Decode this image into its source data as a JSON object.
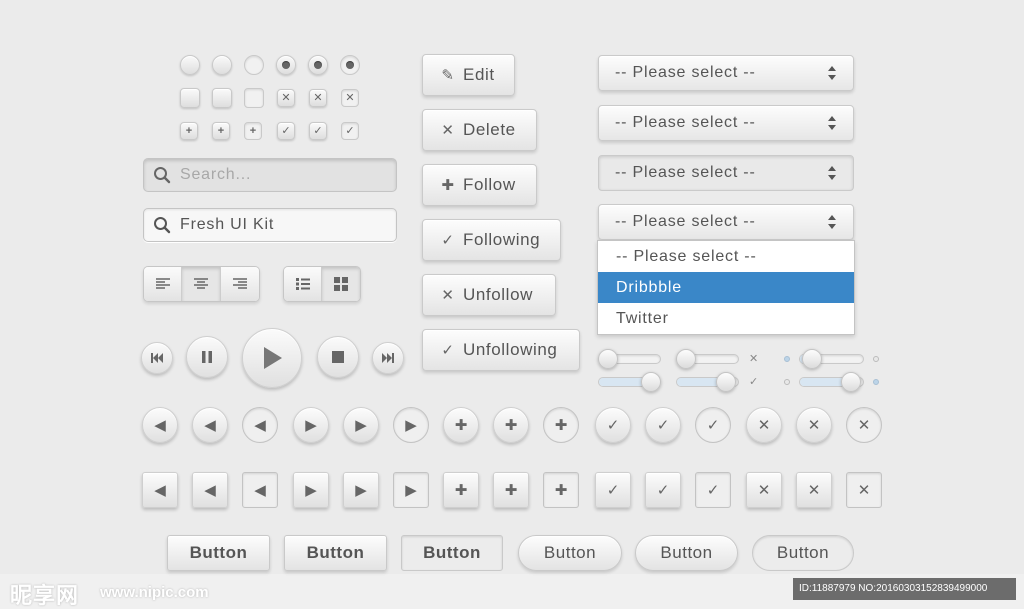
{
  "search": {
    "placeholder": "Search...",
    "value": "Fresh UI Kit"
  },
  "actions": {
    "edit": "Edit",
    "delete": "Delete",
    "follow": "Follow",
    "following": "Following",
    "unfollow": "Unfollow",
    "unfollowing": "Unfollowing"
  },
  "selects": {
    "placeholder": "-- Please select --",
    "options": [
      "-- Please select --",
      "Dribbble",
      "Twitter"
    ],
    "highlighted": "Dribbble"
  },
  "buttons": {
    "label": "Button"
  },
  "sliders": {
    "values": [
      0.05,
      0.05,
      0.1,
      0.95,
      0.9,
      0.9
    ]
  },
  "colors": {
    "accent": "#3a87c8",
    "background": "#ebebeb"
  },
  "watermark": {
    "brand": "昵享网",
    "url": "www.nipic.com",
    "id": "ID:11887979 NO:20160303152839499000"
  }
}
